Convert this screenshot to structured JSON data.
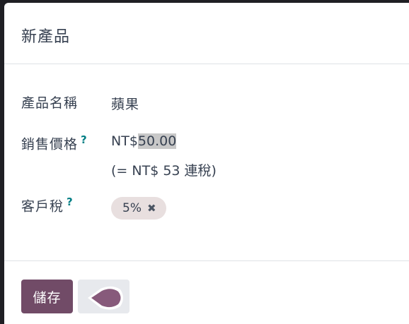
{
  "dialog": {
    "title": "新產品"
  },
  "fields": {
    "name_label": "產品名稱",
    "name_value": "蘋果",
    "price_label": "銷售價格",
    "price_help": "?",
    "price_currency": "NT$",
    "price_amount": "50.00",
    "price_taxed": "(= NT$ 53 連稅)",
    "tax_label": "客戶稅",
    "tax_help": "?",
    "tax_tag": "5%",
    "tax_tag_remove": "✖"
  },
  "footer": {
    "save_label": "儲存"
  },
  "colors": {
    "primary": "#714b67",
    "help": "#017e84",
    "tag_bg": "#e8dfdf"
  }
}
